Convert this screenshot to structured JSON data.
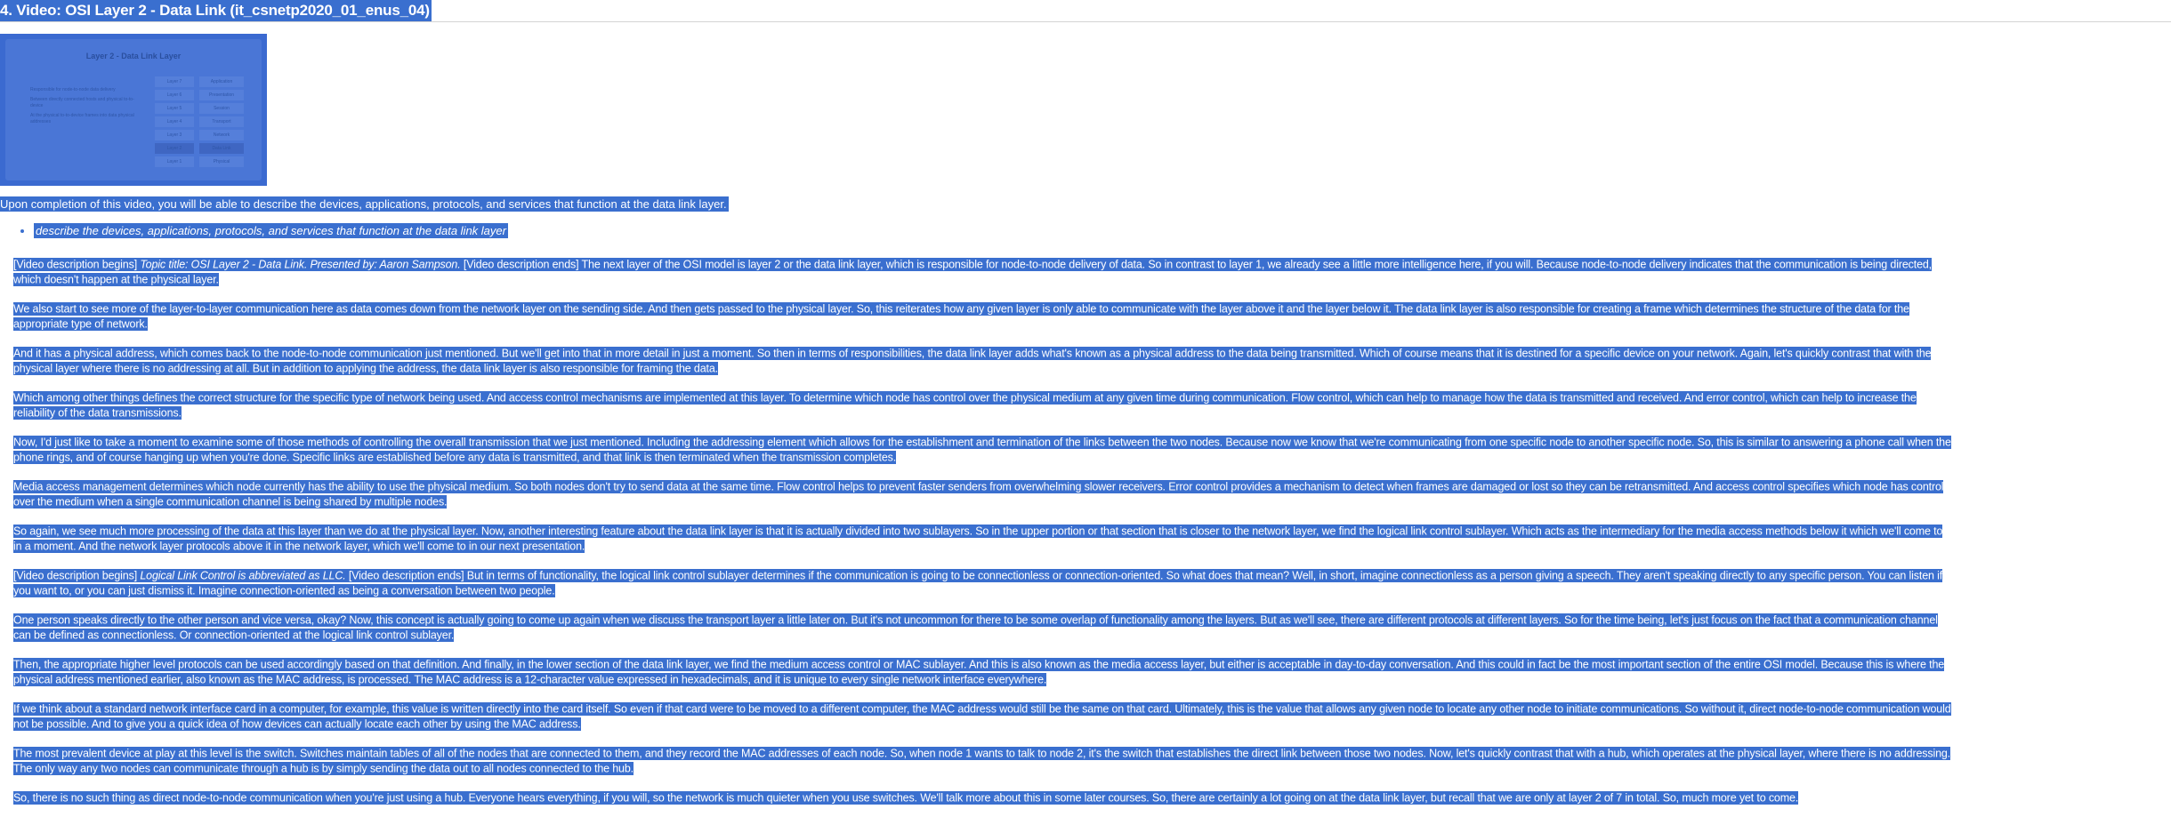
{
  "page": {
    "title": "4. Video: OSI Layer 2 - Data Link (it_csnetp2020_01_enus_04)"
  },
  "thumbnail": {
    "title": "Layer 2 - Data Link Layer",
    "bullets": [
      "Responsible for node-to-node data delivery",
      "Between directly connected hosts and physical to-to-device",
      "At the physical to-to-device frames into data physical addresses"
    ],
    "layers": [
      {
        "label": "Layer 7",
        "name": "Application"
      },
      {
        "label": "Layer 6",
        "name": "Presentation"
      },
      {
        "label": "Layer 5",
        "name": "Session"
      },
      {
        "label": "Layer 4",
        "name": "Transport"
      },
      {
        "label": "Layer 3",
        "name": "Network"
      },
      {
        "label": "Layer 2",
        "name": "Data Link"
      },
      {
        "label": "Layer 1",
        "name": "Physical"
      }
    ]
  },
  "intro": "Upon completion of this video, you will be able to describe the devices, applications, protocols, and services that function at the data link layer.",
  "objectives": [
    "describe the devices, applications, protocols, and services that function at the data link layer"
  ],
  "transcript": {
    "p1_pre": "[Video description begins] ",
    "p1_em": "Topic title: OSI Layer 2 - Data Link. Presented by: Aaron Sampson.",
    "p1_post": " [Video description ends] The next layer of the OSI model is layer 2 or the data link layer, which is responsible for node-to-node delivery of data. So in contrast to layer 1, we already see a little more intelligence here, if you will. Because node-to-node delivery indicates that the communication is being directed, which doesn't happen at the physical layer.",
    "p2": "We also start to see more of the layer-to-layer communication here as data comes down from the network layer on the sending side. And then gets passed to the physical layer. So, this reiterates how any given layer is only able to communicate with the layer above it and the layer below it. The data link layer is also responsible for creating a frame which determines the structure of the data for the appropriate type of network.",
    "p3": "And it has a physical address, which comes back to the node-to-node communication just mentioned. But we'll get into that in more detail in just a moment. So then in terms of responsibilities, the data link layer adds what's known as a physical address to the data being transmitted. Which of course means that it is destined for a specific device on your network. Again, let's quickly contrast that with the physical layer where there is no addressing at all. But in addition to applying the address, the data link layer is also responsible for framing the data.",
    "p4": "Which among other things defines the correct structure for the specific type of network being used. And access control mechanisms are implemented at this layer. To determine which node has control over the physical medium at any given time during communication. Flow control, which can help to manage how the data is transmitted and received. And error control, which can help to increase the reliability of the data transmissions.",
    "p5": "Now, I'd just like to take a moment to examine some of those methods of controlling the overall transmission that we just mentioned. Including the addressing element which allows for the establishment and termination of the links between the two nodes. Because now we know that we're communicating from one specific node to another specific node. So, this is similar to answering a phone call when the phone rings, and of course hanging up when you're done. Specific links are established before any data is transmitted, and that link is then terminated when the transmission completes.",
    "p6": "Media access management determines which node currently has the ability to use the physical medium. So both nodes don't try to send data at the same time. Flow control helps to prevent faster senders from overwhelming slower receivers. Error control provides a mechanism to detect when frames are damaged or lost so they can be retransmitted. And access control specifies which node has control over the medium when a single communication channel is being shared by multiple nodes.",
    "p7": "So again, we see much more processing of the data at this layer than we do at the physical layer. Now, another interesting feature about the data link layer is that it is actually divided into two sublayers. So in the upper portion or that section that is closer to the network layer, we find the logical link control sublayer. Which acts as the intermediary for the media access methods below it which we'll come to in a moment. And the network layer protocols above it in the network layer, which we'll come to in our next presentation.",
    "p8_pre": "[Video description begins] ",
    "p8_em": "Logical Link Control is abbreviated as LLC.",
    "p8_post": " [Video description ends] But in terms of functionality, the logical link control sublayer determines if the communication is going to be connectionless or connection-oriented. So what does that mean? Well, in short, imagine connectionless as a person giving a speech. They aren't speaking directly to any specific person. You can listen if you want to, or you can just dismiss it. Imagine connection-oriented as being a conversation between two people.",
    "p9": "One person speaks directly to the other person and vice versa, okay? Now, this concept is actually going to come up again when we discuss the transport layer a little later on. But it's not uncommon for there to be some overlap of functionality among the layers. But as we'll see, there are different protocols at different layers. So for the time being, let's just focus on the fact that a communication channel can be defined as connectionless. Or connection-oriented at the logical link control sublayer.",
    "p10": "Then, the appropriate higher level protocols can be used accordingly based on that definition. And finally, in the lower section of the data link layer, we find the medium access control or MAC sublayer. And this is also known as the media access layer, but either is acceptable in day-to-day conversation. And this could in fact be the most important section of the entire OSI model. Because this is where the physical address mentioned earlier, also known as the MAC address, is processed. The MAC address is a 12-character value expressed in hexadecimals, and it is unique to every single network interface everywhere.",
    "p11": "If we think about a standard network interface card in a computer, for example, this value is written directly into the card itself. So even if that card were to be moved to a different computer, the MAC address would still be the same on that card. Ultimately, this is the value that allows any given node to locate any other node to initiate communications. So without it, direct node-to-node communication would not be possible. And to give you a quick idea of how devices can actually locate each other by using the MAC address.",
    "p12": "The most prevalent device at play at this level is the switch. Switches maintain tables of all of the nodes that are connected to them, and they record the MAC addresses of each node. So, when node 1 wants to talk to node 2, it's the switch that establishes the direct link between those two nodes. Now, let's quickly contrast that with a hub, which operates at the physical layer, where there is no addressing. The only way any two nodes can communicate through a hub is by simply sending the data out to all nodes connected to the hub.",
    "p13": "So, there is no such thing as direct node-to-node communication when you're just using a hub. Everyone hears everything, if you will, so the network is much quieter when you use switches. We'll talk more about this in some later courses. So, there are certainly a lot going on at the data link layer, but recall that we are only at layer 2 of 7 in total. So, much more yet to come."
  }
}
